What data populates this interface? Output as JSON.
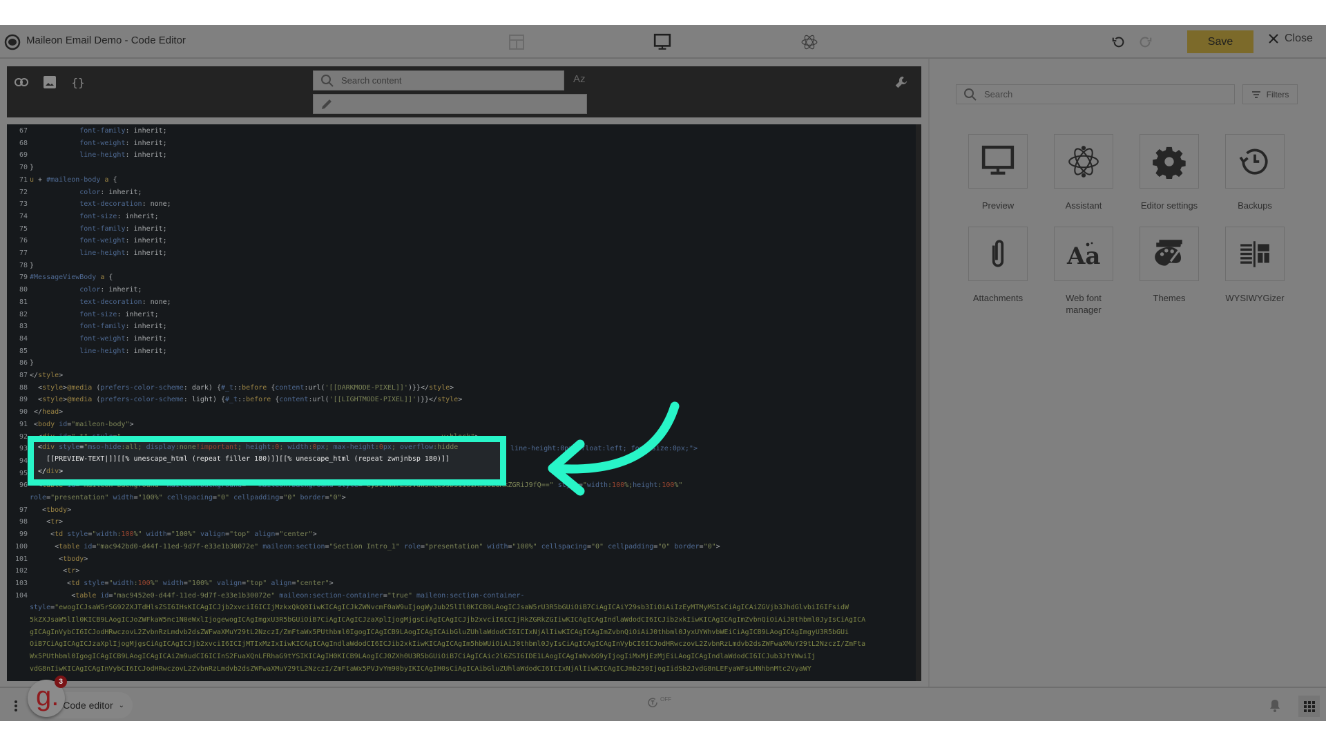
{
  "header": {
    "title": "Maileon Email Demo - Code Editor",
    "save_label": "Save",
    "close_label": "Close",
    "view_icons": [
      "layout-grid-icon",
      "desktop-monitor-icon",
      "atom-icon"
    ]
  },
  "toolbar": {
    "search_placeholder": "Search content",
    "case_toggle": "Az",
    "replace_value": ""
  },
  "editor": {
    "lines": [
      {
        "n": "67",
        "html": "            <span class='k'>font-family</span>: inherit;"
      },
      {
        "n": "68",
        "html": "            <span class='k'>font-weight</span>: inherit;"
      },
      {
        "n": "69",
        "html": "            <span class='k'>line-height</span>: inherit;"
      },
      {
        "n": "70",
        "html": "}"
      },
      {
        "n": "71",
        "html": "<span class='t'>u</span> + <span class='k'>#maileon-body</span> <span class='t'>a</span> {"
      },
      {
        "n": "72",
        "html": "            <span class='k'>color</span>: inherit;"
      },
      {
        "n": "73",
        "html": "            <span class='k'>text-decoration</span>: none;"
      },
      {
        "n": "74",
        "html": "            <span class='k'>font-size</span>: inherit;"
      },
      {
        "n": "75",
        "html": "            <span class='k'>font-family</span>: inherit;"
      },
      {
        "n": "76",
        "html": "            <span class='k'>font-weight</span>: inherit;"
      },
      {
        "n": "77",
        "html": "            <span class='k'>line-height</span>: inherit;"
      },
      {
        "n": "78",
        "html": "}"
      },
      {
        "n": "79",
        "html": "<span class='k'>#MessageViewBody</span> <span class='t'>a</span> {"
      },
      {
        "n": "80",
        "html": "            <span class='k'>color</span>: inherit;"
      },
      {
        "n": "81",
        "html": "            <span class='k'>text-decoration</span>: none;"
      },
      {
        "n": "82",
        "html": "            <span class='k'>font-size</span>: inherit;"
      },
      {
        "n": "83",
        "html": "            <span class='k'>font-family</span>: inherit;"
      },
      {
        "n": "84",
        "html": "            <span class='k'>font-weight</span>: inherit;"
      },
      {
        "n": "85",
        "html": "            <span class='k'>line-height</span>: inherit;"
      },
      {
        "n": "86",
        "html": "}"
      },
      {
        "n": "87",
        "html": "&lt;/<span class='t'>style</span>&gt;"
      },
      {
        "n": "88",
        "html": "  &lt;<span class='t'>style</span>&gt;<span class='t'>@media</span> (<span class='k'>prefers-color-scheme</span>: dark) {<span class='k'>#_t</span>::<span class='t'>before</span> {<span class='k'>content</span>:url(<span class='s'>'[[DARKMODE-PIXEL]]'</span>)}}&lt;/<span class='t'>style</span>&gt;"
      },
      {
        "n": "89",
        "html": "  &lt;<span class='t'>style</span>&gt;<span class='t'>@media</span> (<span class='k'>prefers-color-scheme</span>: light) {<span class='k'>#_t</span>::<span class='t'>before</span> {<span class='k'>content</span>:url(<span class='s'>'[[LIGHTMODE-PIXEL]]'</span>)}}&lt;/<span class='t'>style</span>&gt;"
      },
      {
        "n": "90",
        "html": " &lt;/<span class='t'>head</span>&gt;"
      },
      {
        "n": "91",
        "html": " &lt;<span class='t'>body</span> <span class='k'>id</span>=<span class='s'>\"maileon-body\"</span>&gt;"
      },
      {
        "n": "92",
        "html": "  &lt;<span class='t'>div</span> <span class='k'>id</span>=<span class='s'>\"_t\"</span> <span class='k'>style</span>=<span class='s'>\"...                                                                          y:block\"</span>&gt;"
      },
      {
        "n": "93",
        "html": ""
      },
      {
        "n": "94",
        "html": ""
      },
      {
        "n": "95",
        "html": ""
      },
      {
        "n": "96",
        "html": "  &lt;<span class='t'>table</span> <span class='k'>id</span>=<span class='s'>\"maileon-background\"</span> <span class='k'>maileon:background</span>=<span class='s'>\"\"</span> <span class='k'>maileon:background-style</span>=<span class='s'>\"eyJiYWNrZ3JvdW5kQ29sb3IiOiAiI0ZGRkZGRiJ9fQ==\"</span> <span class='k'>style</span>=<span class='s'>\"<span class='k'>width</span>:<span class='n'>100</span>%;<span class='k'>height</span>:<span class='n'>100</span>%\"</span>"
      },
      {
        "n": "",
        "html": "<span class='k'>role</span>=<span class='s'>\"presentation\"</span> <span class='k'>width</span>=<span class='s'>\"100%\"</span> <span class='k'>cellspacing</span>=<span class='s'>\"0\"</span> <span class='k'>cellpadding</span>=<span class='s'>\"0\"</span> <span class='k'>border</span>=<span class='s'>\"0\"</span>&gt;"
      },
      {
        "n": "97",
        "html": "   &lt;<span class='t'>tbody</span>&gt;"
      },
      {
        "n": "98",
        "html": "    &lt;<span class='t'>tr</span>&gt;"
      },
      {
        "n": "99",
        "html": "     &lt;<span class='t'>td</span> <span class='k'>style</span>=<span class='s'>\"<span class='k'>width</span>:<span class='n'>100</span>%\"</span> <span class='k'>width</span>=<span class='s'>\"100%\"</span> <span class='k'>valign</span>=<span class='s'>\"top\"</span> <span class='k'>align</span>=<span class='s'>\"center\"</span>&gt;"
      },
      {
        "n": "100",
        "html": "      &lt;<span class='t'>table</span> <span class='k'>id</span>=<span class='s'>\"mac942bd0-d44f-11ed-9d7f-e33e1b30072e\"</span> <span class='k'>maileon:section</span>=<span class='s'>\"Section Intro_1\"</span> <span class='k'>role</span>=<span class='s'>\"presentation\"</span> <span class='k'>width</span>=<span class='s'>\"100%\"</span> <span class='k'>cellspacing</span>=<span class='s'>\"0\"</span> <span class='k'>cellpadding</span>=<span class='s'>\"0\"</span> <span class='k'>border</span>=<span class='s'>\"0\"</span>&gt;"
      },
      {
        "n": "101",
        "html": "       &lt;<span class='t'>tbody</span>&gt;"
      },
      {
        "n": "102",
        "html": "        &lt;<span class='t'>tr</span>&gt;"
      },
      {
        "n": "103",
        "html": "         &lt;<span class='t'>td</span> <span class='k'>style</span>=<span class='s'>\"<span class='k'>width</span>:<span class='n'>100</span>%\"</span> <span class='k'>width</span>=<span class='s'>\"100%\"</span> <span class='k'>valign</span>=<span class='s'>\"top\"</span> <span class='k'>align</span>=<span class='s'>\"center\"</span>&gt;"
      },
      {
        "n": "104",
        "html": "          &lt;<span class='t'>table</span> <span class='k'>id</span>=<span class='s'>\"mac9452e0-d44f-11ed-9d7f-e33e1b30072e\"</span> <span class='k'>maileon:section-container</span>=<span class='s'>\"true\"</span> <span class='k'>maileon:section-container-</span>"
      },
      {
        "n": "",
        "html": "<span class='k'>style</span>=<span class='b64'>\"ewogICJsaW5rSG92ZXJTdHlsZSI6IHsKICAgICJjb2xvciI6ICIjMzkxQkQ0IiwKICAgICJkZWNvcmF0aW9uIjogWyJub25lIl0KICB9LAogICJsaW5rU3R5bGUiOiB7CiAgICAiY29sb3IiOiAiIzEyMTMyMSIsCiAgICAiZGVjb3JhdGlvbiI6IFsidW</span>"
      },
      {
        "n": "",
        "html": "<span class='b64'>5kZXJsaW5lIl0KICB9LAogICJoZWFkaW5nc1N0eWxlIjogewogICAgImgxU3R5bGUiOiB7CiAgICAgICJzaXplIjogMjgsCiAgICAgICJjb2xvciI6ICIjRkZGRkZGIiwKICAgICAgIndlaWdodCI6ICJib2xkIiwKICAgICAgImZvbnQiOiAiJ0thbml0JyIsCiAgICA</span>"
      },
      {
        "n": "",
        "html": "<span class='b64'>gICAgInVybCI6ICJodHRwczovL2ZvbnRzLmdvb2dsZWFwaXMuY29tL2NzczI/ZmFtaWx5PUthbml0IgogICAgICB9LAogICAgICAibGluZUhlaWdodCI6ICIxNjAlIiwKICAgICAgImZvbnQiOiAiJ0thbml0JyxUYWhvbWEiCiAgICB9LAogICAgImgyU3R5bGUi</span>"
      },
      {
        "n": "",
        "html": "<span class='b64'>OiB7CiAgICAgICJzaXplIjogMjgsCiAgICAgICJjb2xvciI6ICIjMTIxMzIxIiwKICAgICAgIndlaWdodCI6ICJib2xkIiwKICAgICAgIm5hbWUiOiAiJ0thbml0JyIsCiAgICAgICAgInVybCI6ICJodHRwczovL2ZvbnRzLmdvb2dsZWFwaXMuY29tL2NzczI/ZmFta</span>"
      },
      {
        "n": "",
        "html": "<span class='b64'>Wx5PUthbml0IgogICAgICB9LAogICAgICAiZm9udCI6ICInS2FuaXQnLFRhaG9tYSIKICAgIH0KICB9LAogICJ0ZXh0U3R5bGUiOiB7CiAgICAic2l6ZSI6IDE1LAogICAgImNvbG9yIjogIiMxMjEzMjEiLAogICAgIndlaWdodCI6ICJub3JtYWwiIj</span>"
      },
      {
        "n": "",
        "html": "<span class='b64'>vdG8nIiwKICAgICAgInVybCI6ICJodHRwczovL2ZvbnRzLmdvb2dsZWFwaXMuY29tL2NzczI/ZmFtaWx5PVJvYm90byIKICAgIH0sCiAgICAibGluZUhlaWdodCI6ICIxNjAlIiwKICAgICJmb250IjogIidSb2JvdG8nLEFyaWFsLHNhbnMtc2VyaWY</span>"
      }
    ],
    "highlighted_lines": [
      {
        "n": "93",
        "html": "&lt;<span class='t'>div</span> <span class='k'>style</span>=<span class='s'>\"<span class='k'>mso-hide</span>:all; <span class='k'>display</span>:none<span class='n'>!important</span>; <span class='k'>height</span>:<span class='n'>0</span>; <span class='k'>width</span>:<span class='n'>0</span><span class='k'>px</span>; <span class='k'>max-height</span>:<span class='n'>0</span><span class='k'>px</span>; <span class='k'>overflow</span>:hidde</span>"
      },
      {
        "n": "94",
        "html": " [[PREVIEW-TEXT|]][[% unescape_html (repeat filler 180)]][[% unescape_html (repeat zwnjnbsp 180)]]"
      },
      {
        "n": "95",
        "html": "&lt;/<span class='t'>div</span>&gt;"
      }
    ],
    "line93_overflow": "; line-height:0px; float:left; font-size:0px;\">"
  },
  "right_panel": {
    "search_placeholder": "Search",
    "filters_label": "Filters",
    "tiles": [
      {
        "label": "Preview",
        "icon": "desktop-monitor-icon"
      },
      {
        "label": "Assistant",
        "icon": "atom-icon"
      },
      {
        "label": "Editor settings",
        "icon": "gear-icon"
      },
      {
        "label": "Backups",
        "icon": "history-clock-icon"
      },
      {
        "label": "Attachments",
        "icon": "paperclip-icon"
      },
      {
        "label": "Web font manager",
        "icon": "font-aa-icon"
      },
      {
        "label": "Themes",
        "icon": "palette-icon"
      },
      {
        "label": "WYSIWYGizer",
        "icon": "layout-convert-icon"
      }
    ]
  },
  "bottom_bar": {
    "mode_label": "Code editor",
    "autosave_state": "OFF"
  },
  "avatar": {
    "letter": "g.",
    "badge_count": "3"
  },
  "colors": {
    "accent_highlight": "#28f5c8",
    "save_button": "#7c6a2a",
    "avatar_brand": "#8e1b1e"
  }
}
